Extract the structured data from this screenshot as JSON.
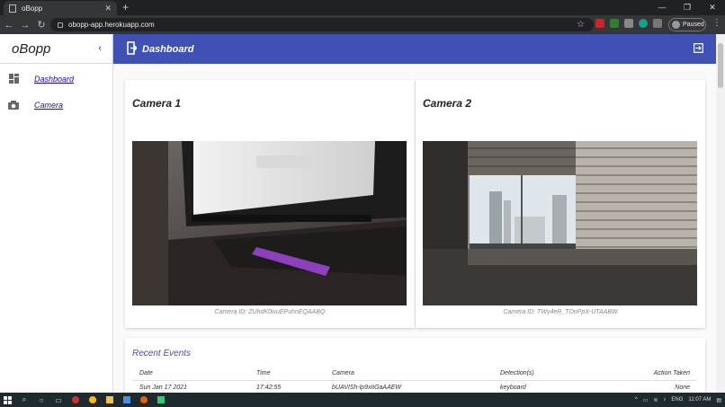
{
  "browser": {
    "tab_title": "oBopp",
    "url": "obopp-app.herokuapp.com",
    "profile_label": "Paused",
    "new_tab": "+",
    "tab_close": "✕"
  },
  "sidebar": {
    "brand": "oBopp",
    "items": [
      {
        "label": "Dashboard",
        "icon": "dashboard-icon"
      },
      {
        "label": "Camera",
        "icon": "camera-icon"
      }
    ]
  },
  "appbar": {
    "title": "Dashboard"
  },
  "cameras": [
    {
      "title": "Camera 1",
      "id_text": "Camera ID: ZUhdK0ivuEPuhnEQAABQ"
    },
    {
      "title": "Camera 2",
      "id_text": "Camera ID: TWy4eR_TOnPpX-UTAABW"
    }
  ],
  "events": {
    "heading": "Recent Events",
    "columns": [
      "Date",
      "Time",
      "Camera",
      "Detection(s)",
      "Action Taken"
    ],
    "rows": [
      [
        "Sun Jan 17 2021",
        "17:42:55",
        "bUAVISh-lp9xIiGaAAEW",
        "keyboard",
        "None"
      ]
    ]
  },
  "taskbar": {
    "language": "ENG",
    "time": "11:07 AM"
  },
  "colors": {
    "primary": "#3f51b5",
    "link": "#1a0dab"
  }
}
